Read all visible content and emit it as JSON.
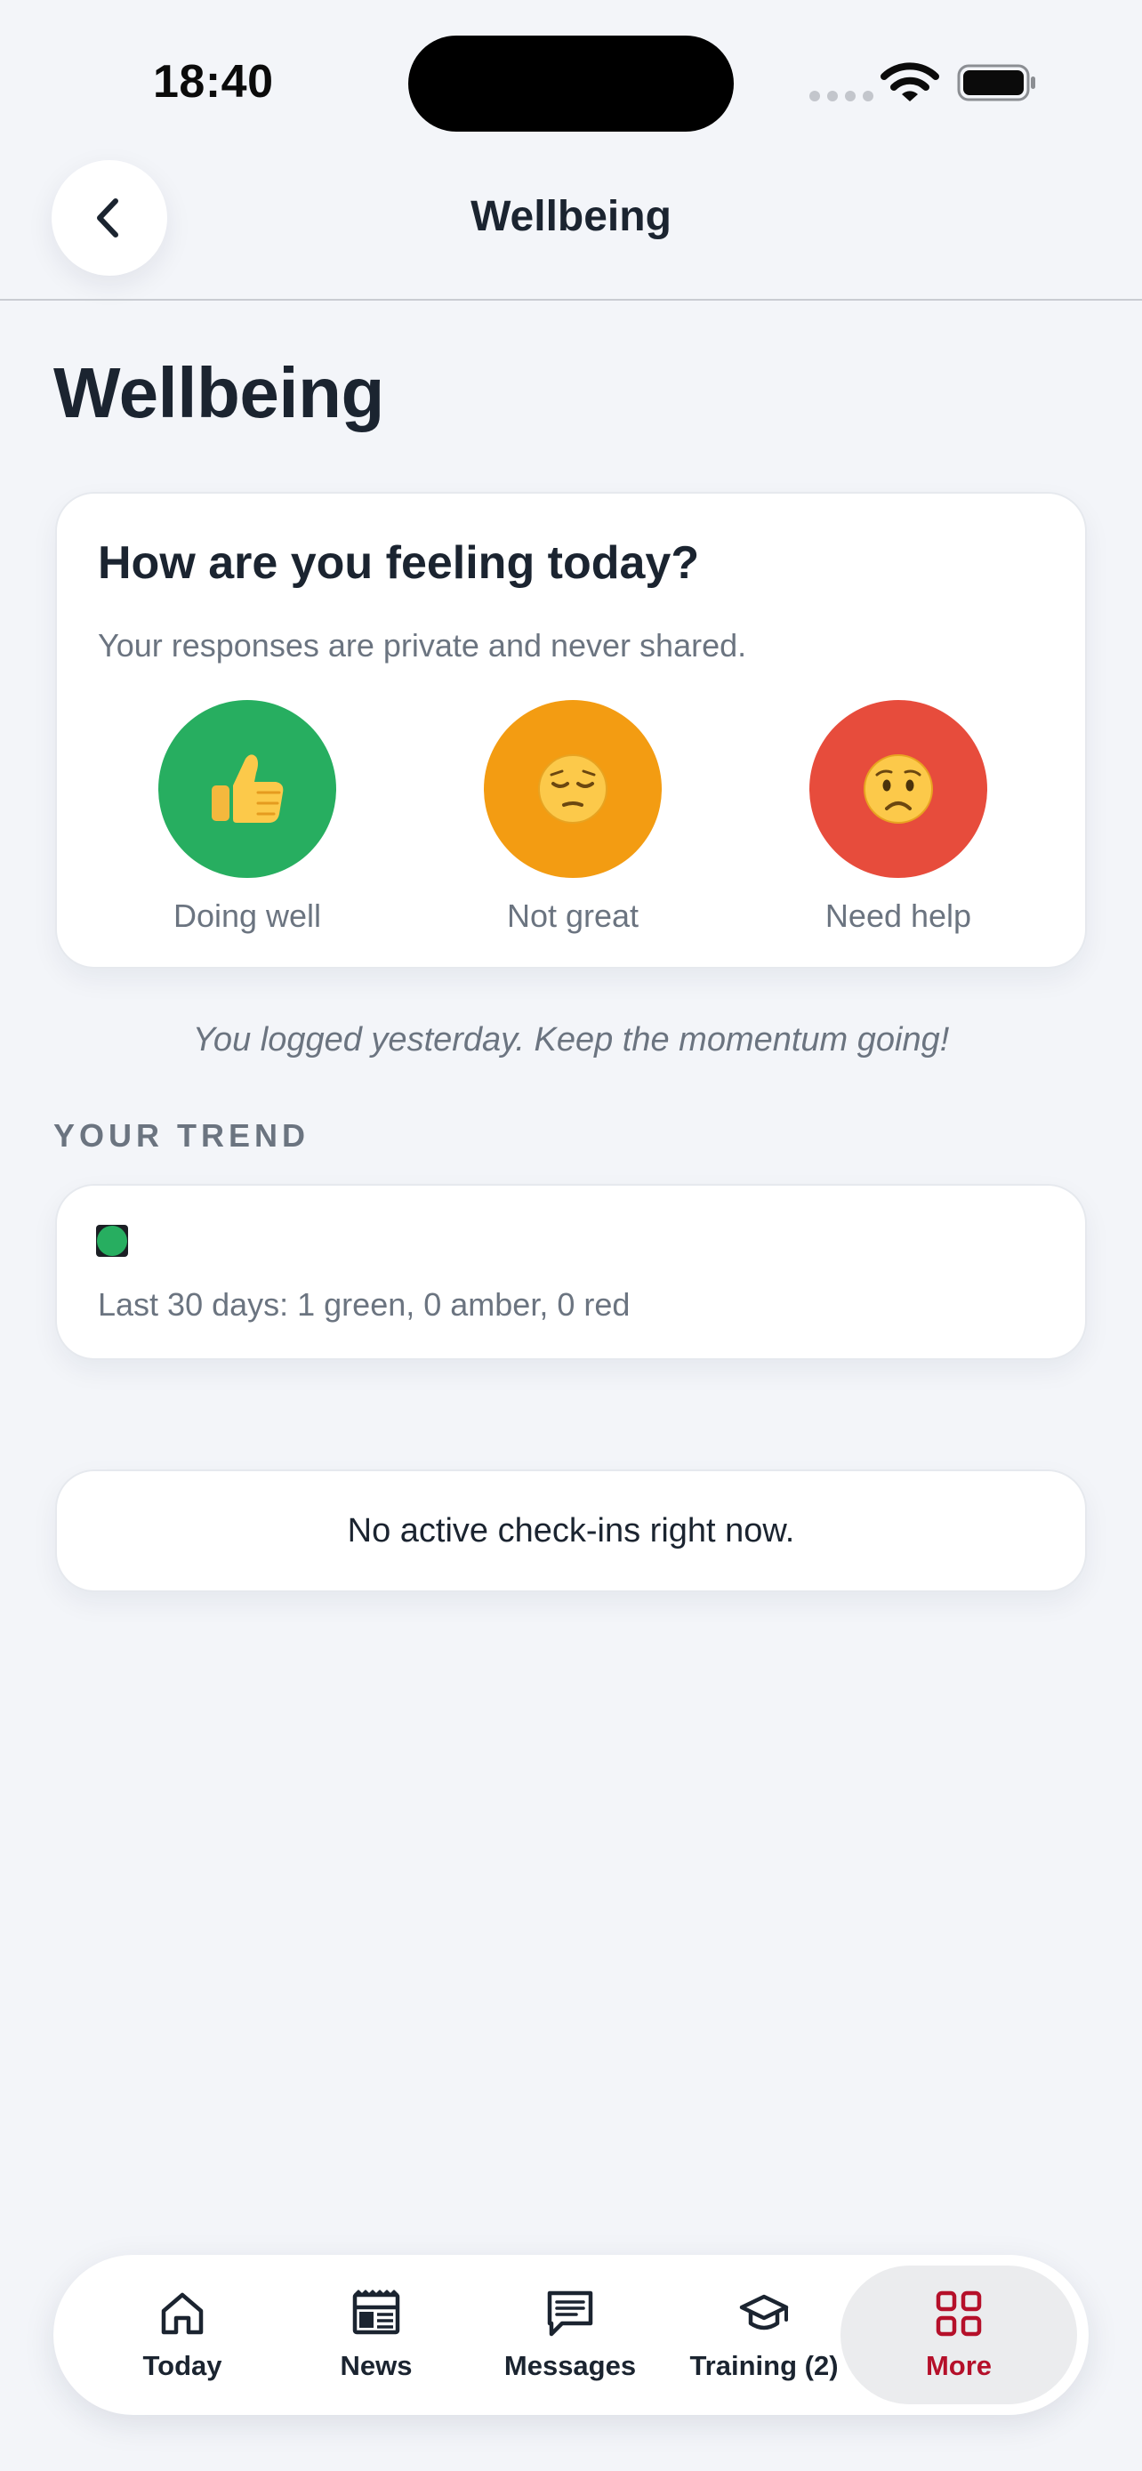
{
  "status_bar": {
    "time": "18:40",
    "icons": [
      "signal-dots-icon",
      "wifi-icon",
      "battery-icon"
    ]
  },
  "header": {
    "title": "Wellbeing",
    "back_icon": "chevron-left-icon"
  },
  "page_title": "Wellbeing",
  "feeling_card": {
    "title": "How are you feeling today?",
    "subtitle": "Your responses are private and never shared.",
    "options": [
      {
        "label": "Doing well",
        "emoji": "👍",
        "color": "#27ae60"
      },
      {
        "label": "Not great",
        "emoji": "😔",
        "color": "#f39c12"
      },
      {
        "label": "Need help",
        "emoji": "😟",
        "color": "#e74c3c"
      }
    ]
  },
  "log_note": "You logged yesterday. Keep the momentum going!",
  "trend": {
    "section_label": "YOUR TREND",
    "summary": "Last 30 days: 1 green, 0 amber, 0 red",
    "dots": [
      "green"
    ],
    "colors": {
      "green": "#27ae60",
      "amber": "#f39c12",
      "red": "#e74c3c"
    }
  },
  "checkins": {
    "empty_text": "No active check-ins right now."
  },
  "tabbar": {
    "accent_color": "#b5102a",
    "tabs": [
      {
        "label": "Today",
        "icon": "home-icon"
      },
      {
        "label": "News",
        "icon": "newspaper-icon"
      },
      {
        "label": "Messages",
        "icon": "message-icon"
      },
      {
        "label": "Training (2)",
        "icon": "graduation-cap-icon"
      },
      {
        "label": "More",
        "icon": "grid-icon",
        "active": true
      }
    ]
  }
}
